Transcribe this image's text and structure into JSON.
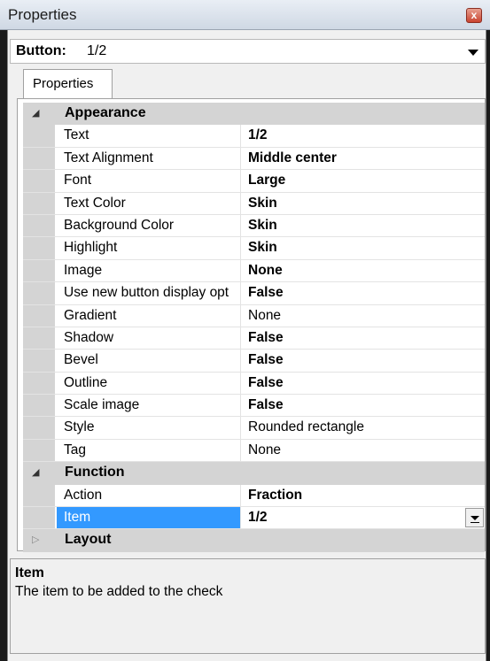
{
  "window": {
    "title": "Properties",
    "close_glyph": "x"
  },
  "object_selector": {
    "type": "Button:",
    "name": "1/2"
  },
  "tabs": [
    {
      "label": "Properties"
    }
  ],
  "grid": {
    "appearance": {
      "label": "Appearance",
      "rows": [
        {
          "name": "Text",
          "value": "1/2",
          "bold": true
        },
        {
          "name": "Text Alignment",
          "value": "Middle center",
          "bold": true
        },
        {
          "name": "Font",
          "value": "Large",
          "bold": true
        },
        {
          "name": "Text Color",
          "value": "Skin",
          "bold": true
        },
        {
          "name": "Background Color",
          "value": "Skin",
          "bold": true
        },
        {
          "name": "Highlight",
          "value": "Skin",
          "bold": true
        },
        {
          "name": "Image",
          "value": "None",
          "bold": true
        },
        {
          "name": "Use new button display opt",
          "value": "False",
          "bold": true
        },
        {
          "name": "Gradient",
          "value": "None",
          "bold": false
        },
        {
          "name": "Shadow",
          "value": "False",
          "bold": true
        },
        {
          "name": "Bevel",
          "value": "False",
          "bold": true
        },
        {
          "name": "Outline",
          "value": "False",
          "bold": true
        },
        {
          "name": "Scale image",
          "value": "False",
          "bold": true
        },
        {
          "name": "Style",
          "value": "Rounded rectangle",
          "bold": false
        },
        {
          "name": "Tag",
          "value": "None",
          "bold": false
        }
      ]
    },
    "function": {
      "label": "Function",
      "rows": [
        {
          "name": "Action",
          "value": "Fraction",
          "bold": true
        },
        {
          "name": "Item",
          "value": "1/2",
          "bold": true,
          "selected": true
        }
      ]
    },
    "layout": {
      "label": "Layout",
      "collapsed": true
    }
  },
  "description": {
    "title": "Item",
    "text": "The item to be added to the check"
  },
  "icons": {
    "expanded": "triangle-down-icon",
    "collapsed": "triangle-right-icon",
    "dropdown": "chevron-down-icon",
    "close": "close-icon"
  },
  "colors": {
    "selection": "#3399ff",
    "category_band": "#d4d4d4",
    "close_button": "#c9432f"
  }
}
